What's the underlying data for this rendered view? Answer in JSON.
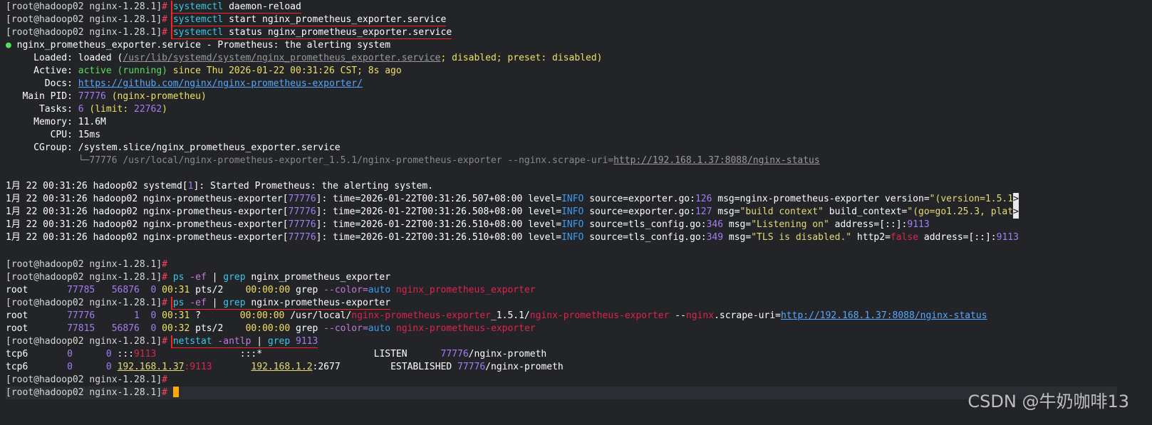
{
  "prompt": "[root@hadoop02 nginx-1.28.1]",
  "hash": "#",
  "cmds": {
    "c1": {
      "name": "systemctl",
      "rest": " daemon-reload"
    },
    "c2": {
      "name": "systemctl",
      "rest": " start nginx_prometheus_exporter.service"
    },
    "c3": {
      "name": "systemctl",
      "rest": " status nginx_prometheus_exporter.service"
    },
    "c4": {
      "name": "ps",
      "opt": " -ef",
      "pipe": " | ",
      "grep": "grep",
      "rest": " nginx_prometheus_exporter"
    },
    "c5": {
      "name": "ps",
      "opt": " -ef",
      "pipe": " | ",
      "grep": "grep",
      "rest": " nginx-prometheus-exporter"
    },
    "c6": {
      "name": "netstat",
      "opt": " -antlp",
      "pipe": " | ",
      "grep": "grep",
      "rest": " 9113"
    }
  },
  "status": {
    "dot": "●",
    "unit": " nginx_prometheus_exporter.service - Prometheus: the alerting system",
    "loaded_label": "     Loaded:",
    "loaded_val": " loaded (",
    "loaded_path": "/usr/lib/systemd/system/nginx_prometheus_exporter.service",
    "loaded_tail": "; disabled; preset: disabled)",
    "active_label": "     Active:",
    "active_val": " active (running)",
    "active_since": " since Thu 2026-01-22 00:31:26 CST; 8s ago",
    "docs_label": "       Docs:",
    "docs_url": "https://github.com/nginx/nginx-prometheus-exporter/",
    "pid_label": "   Main PID:",
    "pid_num": " 77776",
    "pid_name": " (nginx-prometheu)",
    "tasks_label": "      Tasks:",
    "tasks_num": " 6",
    "tasks_limit_a": " (limit: ",
    "tasks_limit": "22762",
    "tasks_limit_b": ")",
    "mem_label": "     Memory:",
    "mem_val": " 11.6M",
    "cpu_label": "        CPU:",
    "cpu_val": " 15ms",
    "cgroup_label": "     CGroup:",
    "cgroup_val": " /system.slice/nginx_prometheus_exporter.service",
    "cgroup_proc": "             └─77776 /usr/local/nginx-prometheus-exporter_1.5.1/nginx-prometheus-exporter --nginx.scrape-uri=",
    "cgroup_url": "http://192.168.1.37:8088/nginx-status"
  },
  "journal": {
    "j1": {
      "date": "1月 22 00:31:26",
      "host": " hadoop02 ",
      "proc": "systemd",
      "pid": "1",
      "msg": ": Started Prometheus: the alerting system."
    },
    "j2": {
      "date": "1月 22 00:31:26",
      "host": " hadoop02 ",
      "proc": "nginx-prometheus-exporter",
      "pid": "77776",
      "time": "2026-01-22T00:31:26.507+08:00",
      "src": "exporter.go",
      "line": "126",
      "msg_a": " msg=nginx-prometheus-exporter version=",
      "msg_b": "\"(version=1.5.1"
    },
    "j3": {
      "date": "1月 22 00:31:26",
      "host": " hadoop02 ",
      "proc": "nginx-prometheus-exporter",
      "pid": "77776",
      "time": "2026-01-22T00:31:26.508+08:00",
      "src": "exporter.go",
      "line": "127",
      "msg_a": " msg=",
      "msg_b": "\"build context\"",
      "msg_c": " build_context=",
      "msg_d": "\"(go=go1.25.3, plat"
    },
    "j4": {
      "date": "1月 22 00:31:26",
      "host": " hadoop02 ",
      "proc": "nginx-prometheus-exporter",
      "pid": "77776",
      "time": "2026-01-22T00:31:26.510+08:00",
      "src": "tls_config.go",
      "line": "346",
      "msg_a": " msg=",
      "msg_b": "\"Listening on\"",
      "msg_c": " address=[::]:",
      "port": "9113"
    },
    "j5": {
      "date": "1月 22 00:31:26",
      "host": " hadoop02 ",
      "proc": "nginx-prometheus-exporter",
      "pid": "77776",
      "time": "2026-01-22T00:31:26.510+08:00",
      "src": "tls_config.go",
      "line": "349",
      "msg_a": " msg=",
      "msg_b": "\"TLS is disabled.\"",
      "msg_c": " http2=",
      "http2": "false",
      "msg_d": " address=[::]:",
      "port": "9113"
    },
    "level_key": " level=",
    "level_val": "INFO",
    "source_key": " source=",
    "time_key": ": time=",
    "trunc": ">"
  },
  "ps": {
    "r1": {
      "user": "root",
      "pid": "       77785",
      "ppid": "   56876",
      "c": "  0",
      "stime": " 00:31",
      "tty": " pts/2",
      "time": "    00:00:00 ",
      "cmd": "grep ",
      "opt": "--color=",
      "auto": "auto",
      "arg": " nginx_prometheus_exporter"
    },
    "r2": {
      "user": "root",
      "pid": "       77776",
      "ppid": "       1",
      "c": "  0",
      "stime": " 00:31",
      "tty": " ?",
      "time": "       00:00:00 ",
      "path_a": "/usr/local/",
      "path_b": "nginx-prometheus-exporter",
      "path_c": "_1.5.1/",
      "path_d": "nginx-prometheus-exporter",
      "flag_a": " --",
      "flag_b": "nginx",
      "flag_c": ".scrape-uri=",
      "url": "http://192.168.1.37:8088/nginx-status"
    },
    "r3": {
      "user": "root",
      "pid": "       77815",
      "ppid": "   56876",
      "c": "  0",
      "stime": " 00:32",
      "tty": " pts/2",
      "time": "    00:00:00 ",
      "cmd": "grep ",
      "opt": "--color=",
      "auto": "auto",
      "arg": " nginx-prometheus-exporter"
    }
  },
  "netstat": {
    "r1": {
      "proto": "tcp6",
      "recv": "       0",
      "send": "      0",
      "local_a": " :::",
      "local_port": "9113",
      "foreign": "               :::*",
      "state": "                    LISTEN      ",
      "pid": "77776",
      "prog": "/nginx-prometh"
    },
    "r2": {
      "proto": "tcp6",
      "recv": "       0",
      "send": "      0",
      "local_ip": "192.168.1.37",
      "local_port": ":9113",
      "foreign_ip": "192.168.1.2",
      "foreign_port": ":2677",
      "state": "         ESTABLISHED ",
      "pid": "77776",
      "prog": "/nginx-prometh"
    }
  },
  "watermark": "CSDN @牛奶咖啡13"
}
